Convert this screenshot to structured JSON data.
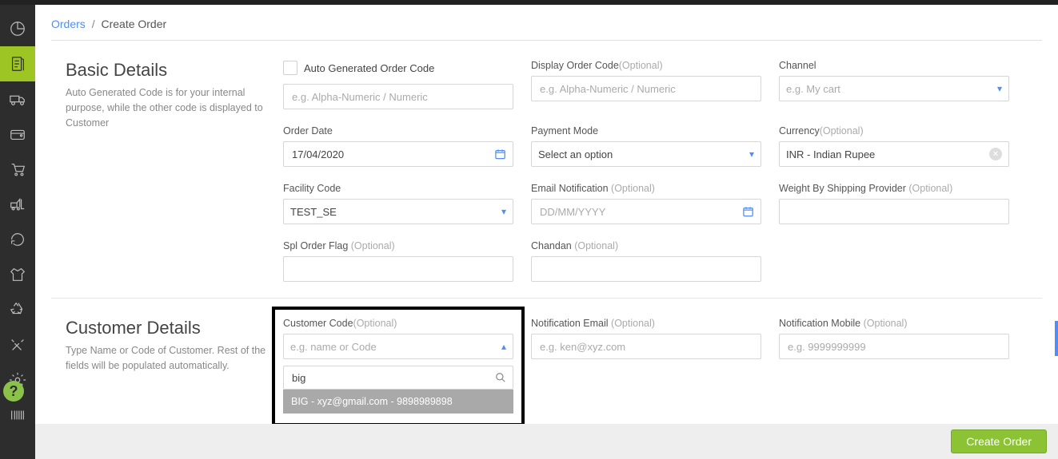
{
  "breadcrumb": {
    "parent": "Orders",
    "current": "Create Order"
  },
  "sections": {
    "basic": {
      "title": "Basic Details",
      "desc": "Auto Generated Code is for your internal purpose, while the other code is displayed to Customer"
    },
    "customer": {
      "title": "Customer Details",
      "desc": "Type Name or Code of Customer. Rest of the fields will be populated automatically."
    }
  },
  "labels": {
    "auto_generated": "Auto Generated Order Code",
    "display_order": "Display Order Code",
    "channel": "Channel",
    "order_date": "Order Date",
    "payment_mode": "Payment Mode",
    "currency": "Currency",
    "facility_code": "Facility Code",
    "email_notif": "Email Notification ",
    "weight": "Weight By Shipping Provider ",
    "spl_order": "Spl Order Flag ",
    "chandan": "Chandan ",
    "customer_code": "Customer Code",
    "notif_email": "Notification Email ",
    "notif_mobile": "Notification Mobile ",
    "optional": "(Optional)"
  },
  "placeholders": {
    "alpha_numeric": "e.g. Alpha-Numeric / Numeric",
    "my_cart": "e.g. My cart",
    "select_option": "Select an option",
    "date": "DD/MM/YYYY",
    "name_or_code": "e.g. name or Code",
    "email_ex": "e.g. ken@xyz.com",
    "mobile_ex": "e.g. 9999999999"
  },
  "values": {
    "order_date": "17/04/2020",
    "currency": "INR - Indian Rupee",
    "facility_code": "TEST_SE",
    "customer_search": "big"
  },
  "dropdown": {
    "customer_result": "BIG - xyz@gmail.com - 9898989898"
  },
  "footer": {
    "create_order": "Create Order"
  }
}
